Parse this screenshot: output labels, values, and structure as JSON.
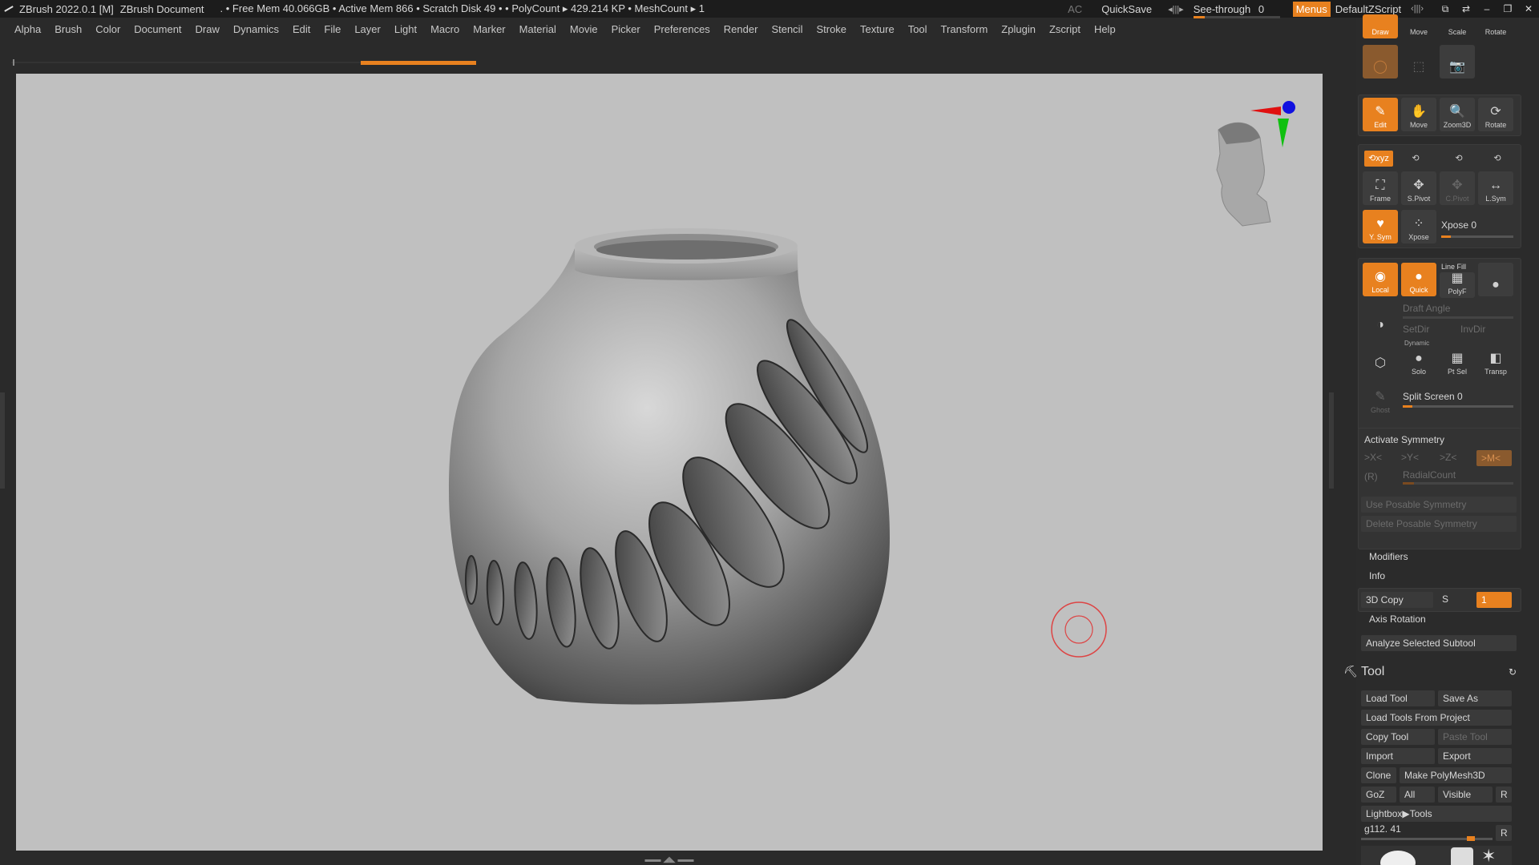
{
  "titlebar": {
    "app": "ZBrush 2022.0.1 [M]",
    "document": "ZBrush Document",
    "status": ". • Free Mem 40.066GB • Active Mem 866 • Scratch Disk 49 • • PolyCount ▸ 429.214 KP • MeshCount ▸ 1",
    "ac": "AC",
    "quicksave": "QuickSave",
    "see_through_label": "See-through",
    "see_through_value": "0",
    "menus": "Menus",
    "zscript": "DefaultZScript"
  },
  "menubar": [
    "Alpha",
    "Brush",
    "Color",
    "Document",
    "Draw",
    "Dynamics",
    "Edit",
    "File",
    "Layer",
    "Light",
    "Macro",
    "Marker",
    "Material",
    "Movie",
    "Picker",
    "Preferences",
    "Render",
    "Stencil",
    "Stroke",
    "Texture",
    "Tool",
    "Transform",
    "Zplugin",
    "Zscript",
    "Help"
  ],
  "viewport": {
    "background": "#c0c0c0",
    "model": "vase-with-slots"
  },
  "panel": {
    "top_tools": [
      "Draw",
      "Move",
      "Scale",
      "Rotate"
    ],
    "nav": [
      "Edit",
      "Move",
      "Zoom3D",
      "Rotate"
    ],
    "frame_row": [
      "Frame",
      "S.Pivot",
      "C.Pivot",
      "L.Sym"
    ],
    "sym_row": [
      "Y. Sym",
      "Xpose"
    ],
    "xpose_label": "Xpose",
    "xpose_value": "0",
    "line_fill": "Line Fill",
    "render_row": [
      "Local",
      "Quick",
      "PolyF"
    ],
    "draft_angle": "Draft Angle",
    "setdir": "SetDir",
    "invdir": "InvDir",
    "dynamic": "Dynamic",
    "solo_row": [
      "Solo",
      "Pt Sel",
      "Transp"
    ],
    "ghost": "Ghost",
    "split_screen": "Split Screen",
    "split_screen_value": "0",
    "activate_symmetry": "Activate Symmetry",
    "axes": [
      ">X<",
      ">Y<",
      ">Z<",
      ">M<"
    ],
    "r_label": "(R)",
    "radial_count": "RadialCount",
    "use_posable": "Use Posable Symmetry",
    "delete_posable": "Delete Posable Symmetry",
    "modifiers": "Modifiers",
    "info": "Info",
    "copy3d": "3D Copy",
    "s_label": "S",
    "copy_value": "1",
    "axis_rotation": "Axis Rotation",
    "analyze": "Analyze Selected Subtool",
    "tool_title": "Tool",
    "load_tool": "Load Tool",
    "save_as": "Save As",
    "load_from_project": "Load Tools From Project",
    "copy_tool": "Copy Tool",
    "paste_tool": "Paste Tool",
    "import": "Import",
    "export": "Export",
    "clone": "Clone",
    "make_polymesh": "Make PolyMesh3D",
    "goz": "GoZ",
    "all": "All",
    "visible": "Visible",
    "r": "R",
    "lightbox_tools": "Lightbox▶Tools",
    "tool_name": "g112. 41",
    "tool_r": "R"
  },
  "colors": {
    "accent": "#e8811f",
    "panel": "#2b2b2b"
  }
}
